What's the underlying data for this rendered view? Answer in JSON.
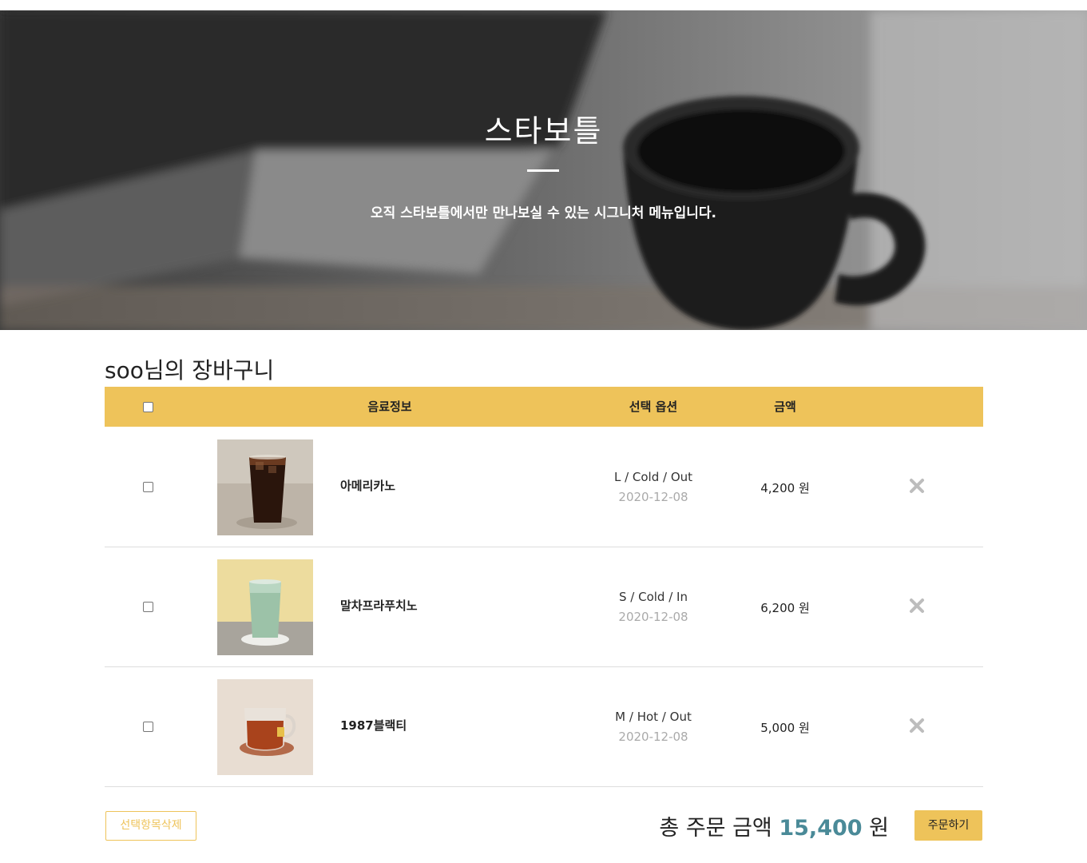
{
  "hero": {
    "title": "스타보틀",
    "subtitle": "오직 스타보틀에서만 만나보실 수 있는 시그니처 메뉴입니다."
  },
  "cart": {
    "title": "soo님의 장바구니",
    "headers": {
      "info": "음료정보",
      "option": "선택 옵션",
      "price": "금액"
    },
    "items": [
      {
        "name": "아메리카노",
        "option": "L / Cold / Out",
        "date": "2020-12-08",
        "price": "4,200 원"
      },
      {
        "name": "말차프라푸치노",
        "option": "S / Cold / In",
        "date": "2020-12-08",
        "price": "6,200 원"
      },
      {
        "name": "1987블랙티",
        "option": "M / Hot / Out",
        "date": "2020-12-08",
        "price": "5,000 원"
      }
    ]
  },
  "footer": {
    "delete_selected": "선택항목삭제",
    "total_label": "총 주문 금액",
    "total_value": "15,400",
    "total_unit": "원",
    "order_button": "주문하기"
  },
  "colors": {
    "accent": "#eec35a",
    "total": "#4a8a98"
  }
}
